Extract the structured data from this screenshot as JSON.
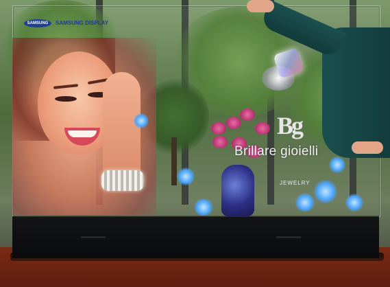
{
  "display": {
    "logo_oval": "SAMSUNG",
    "logo_text": "SAMSUNG DISPLAY"
  },
  "ad": {
    "brand_monogram": "Bg",
    "brand_name": "Brillare gioielli",
    "brand_tagline": "JEWELRY"
  },
  "colors": {
    "samsung_blue": "#1b3f9a",
    "floor_wood": "#6b2412",
    "stand_black": "#0e0f10"
  }
}
